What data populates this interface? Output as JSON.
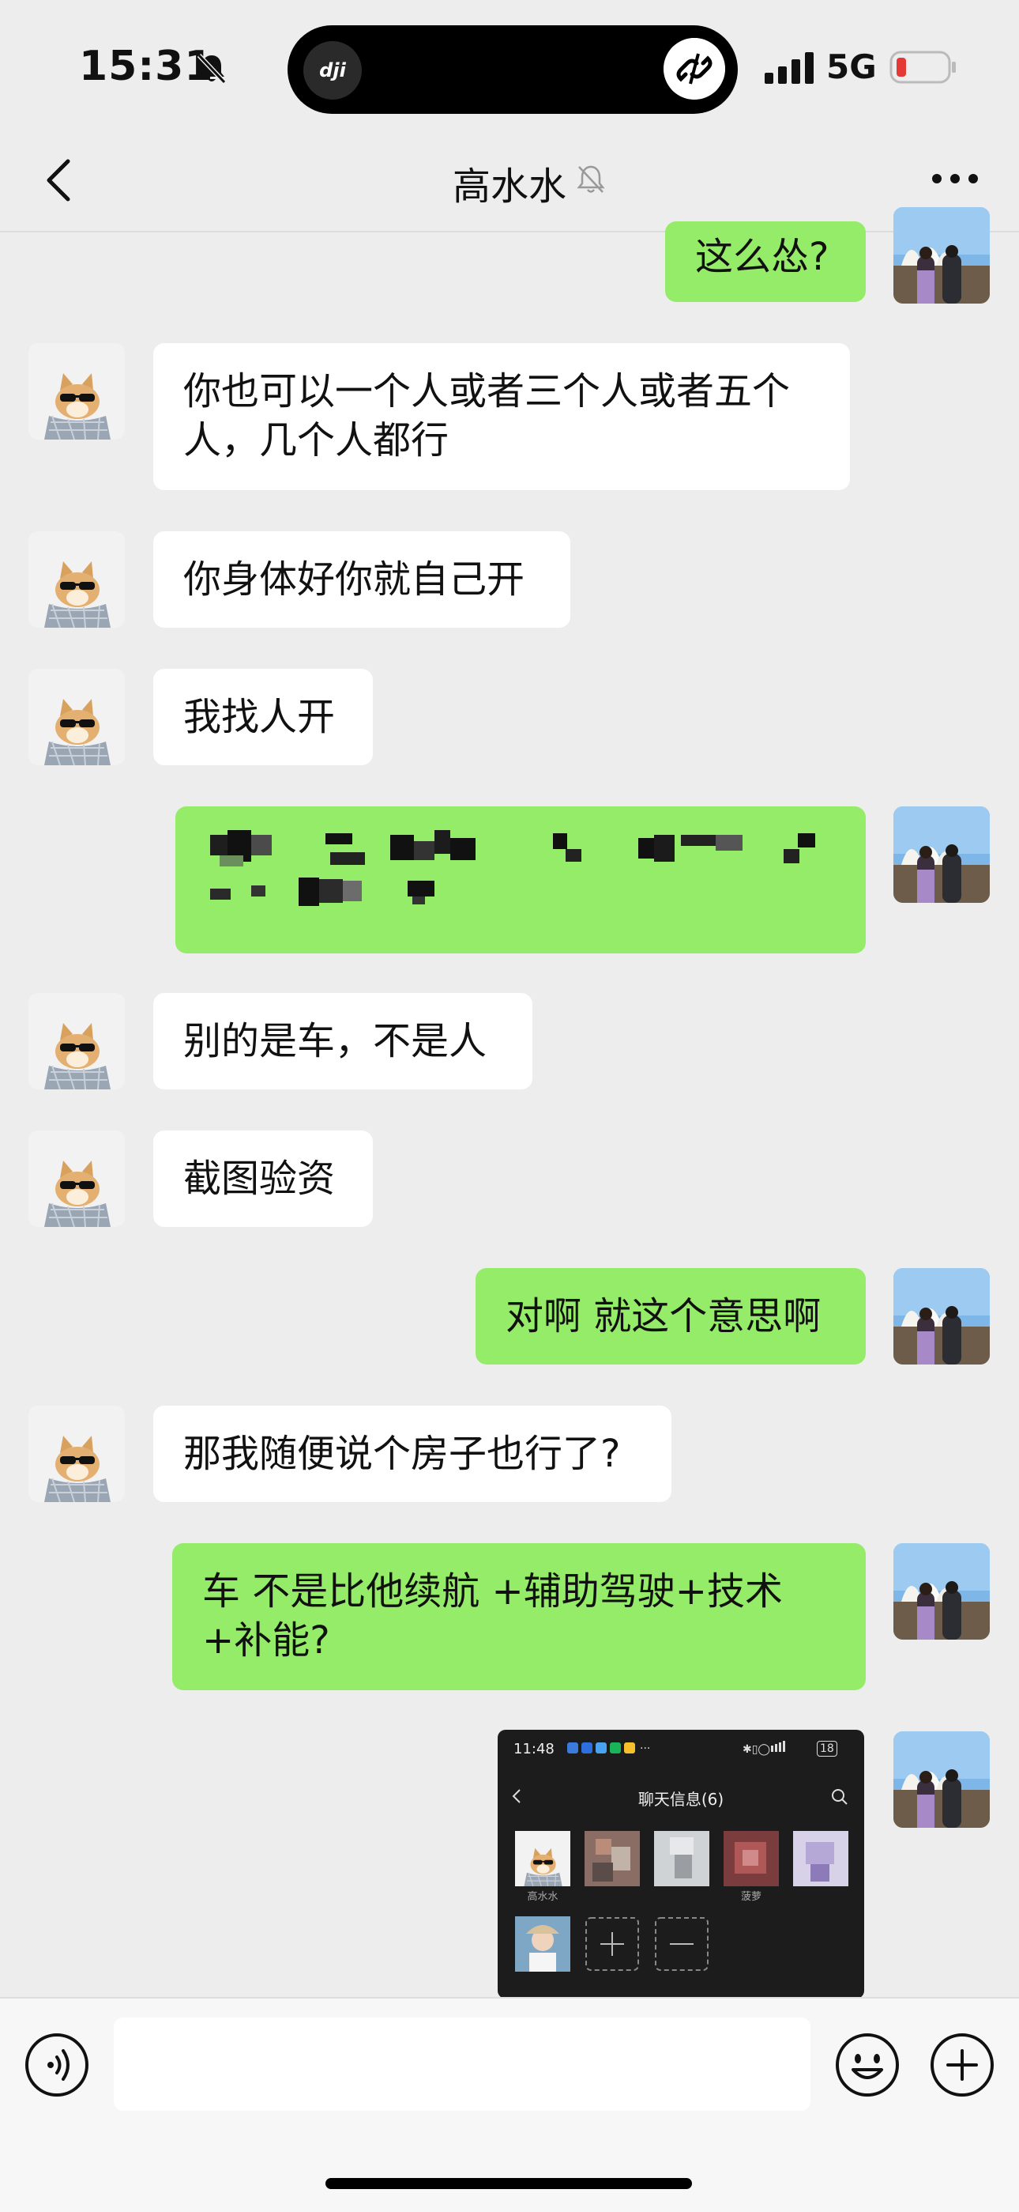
{
  "status_bar": {
    "time": "15:31",
    "network": "5G",
    "island_app_label": "dji"
  },
  "nav": {
    "title": "高水水"
  },
  "messages": [
    {
      "side": "out",
      "text": "这么怂?"
    },
    {
      "side": "in",
      "text": "你也可以一个人或者三个人或者五个人，几个人都行"
    },
    {
      "side": "in",
      "text": "你身体好你就自己开"
    },
    {
      "side": "in",
      "text": "我找人开"
    },
    {
      "side": "out",
      "text": "[pixelated]"
    },
    {
      "side": "in",
      "text": "别的是车，不是人"
    },
    {
      "side": "in",
      "text": "截图验资"
    },
    {
      "side": "out",
      "text": "对啊 就这个意思啊"
    },
    {
      "side": "in",
      "text": "那我随便说个房子也行了?"
    },
    {
      "side": "out",
      "text": "车 不是比他续航 +辅助驾驶+技术+补能?"
    }
  ],
  "screenshot": {
    "time": "11:48",
    "battery": "18",
    "title": "聊天信息(6)",
    "member_names": [
      "高水水",
      "",
      "",
      "菠萝",
      ""
    ]
  },
  "input": {
    "placeholder": ""
  },
  "colors": {
    "outgoing_bubble": "#95ec69",
    "incoming_bubble": "#ffffff",
    "background": "#ededed"
  }
}
